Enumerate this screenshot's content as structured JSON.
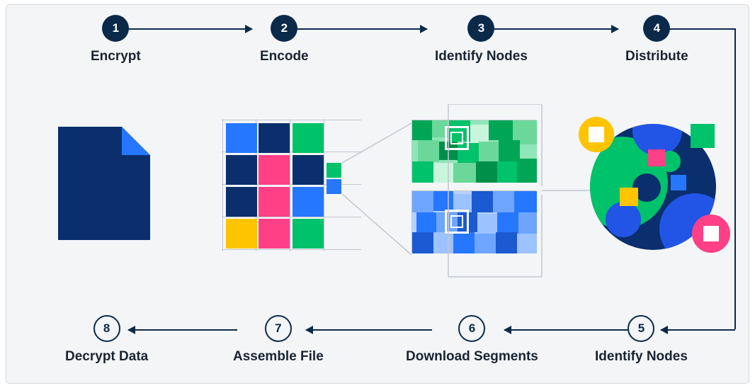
{
  "steps_top": [
    {
      "num": "1",
      "label": "Encrypt"
    },
    {
      "num": "2",
      "label": "Encode"
    },
    {
      "num": "3",
      "label": "Identify Nodes"
    },
    {
      "num": "4",
      "label": "Distribute"
    }
  ],
  "steps_bottom": [
    {
      "num": "8",
      "label": "Decrypt Data"
    },
    {
      "num": "7",
      "label": "Assemble File"
    },
    {
      "num": "6",
      "label": "Download Segments"
    },
    {
      "num": "5",
      "label": "Identify Nodes"
    }
  ],
  "palette": {
    "darknavy": "#0a2f6c",
    "blue": "#2677ff",
    "green": "#00c26a",
    "pink": "#ff4086",
    "yellow": "#ffc400",
    "lightgrey": "#c1c7d0"
  }
}
